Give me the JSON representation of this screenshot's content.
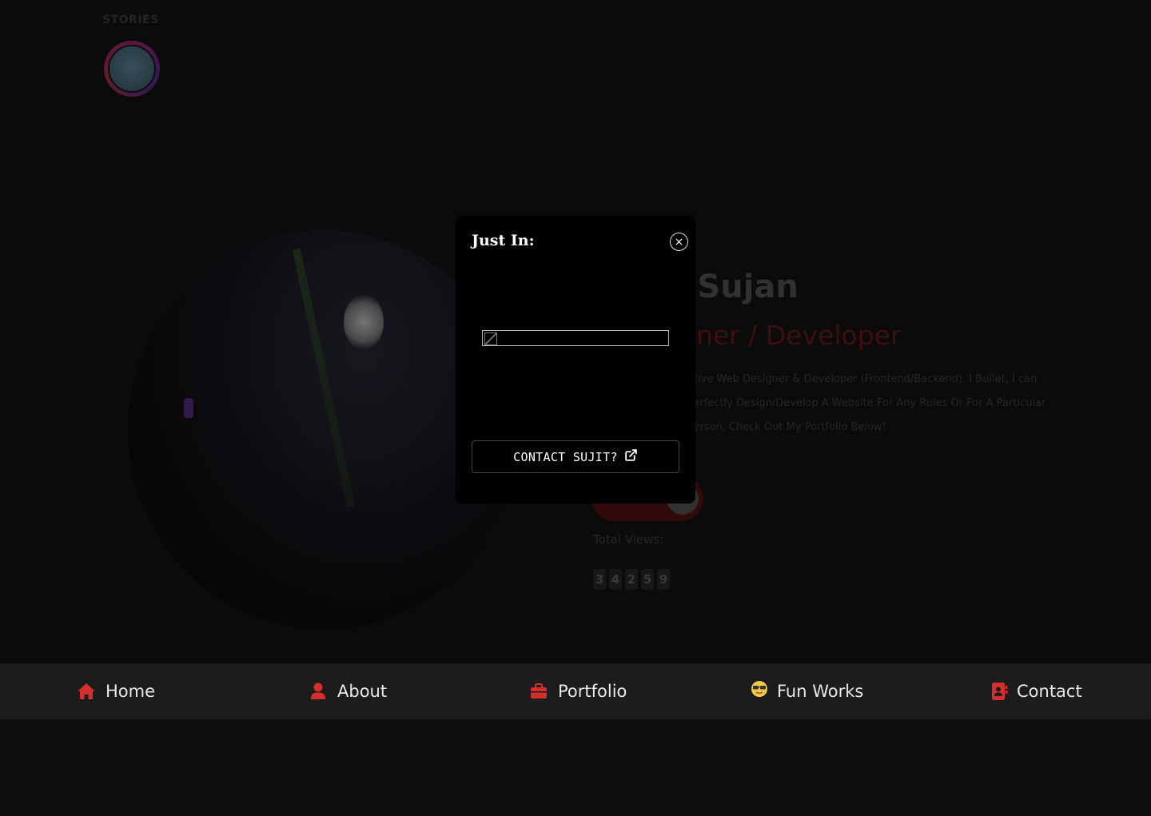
{
  "stories": {
    "label": "STORIES"
  },
  "hero": {
    "name": "n Sujan",
    "role": "gner / Developer",
    "bio": "ative Web Designer & Developer (Frontend/Backend). I Bullet, I can Perfectly Design/Develop A Website For Any Rules Or For A Particular Person. Check Out My Portfolio Below!",
    "total_label": "Total Views:",
    "total_digits": [
      "3",
      "4",
      "2",
      "5",
      "9"
    ]
  },
  "modal": {
    "title": "Just In:",
    "close_symbol": "×",
    "cta_label": "CONTACT SUJIT?"
  },
  "nav": {
    "items": [
      {
        "label": "Home",
        "icon": "home-icon"
      },
      {
        "label": "About",
        "icon": "user-icon"
      },
      {
        "label": "Portfolio",
        "icon": "briefcase-icon"
      },
      {
        "label": "Fun Works",
        "icon": "sunglasses-face-icon"
      },
      {
        "label": "Contact",
        "icon": "contact-book-icon"
      }
    ]
  },
  "colors": {
    "accent": "#d32f2f",
    "nav_bg": "#1c1c1c",
    "modal_bg": "#000000"
  }
}
